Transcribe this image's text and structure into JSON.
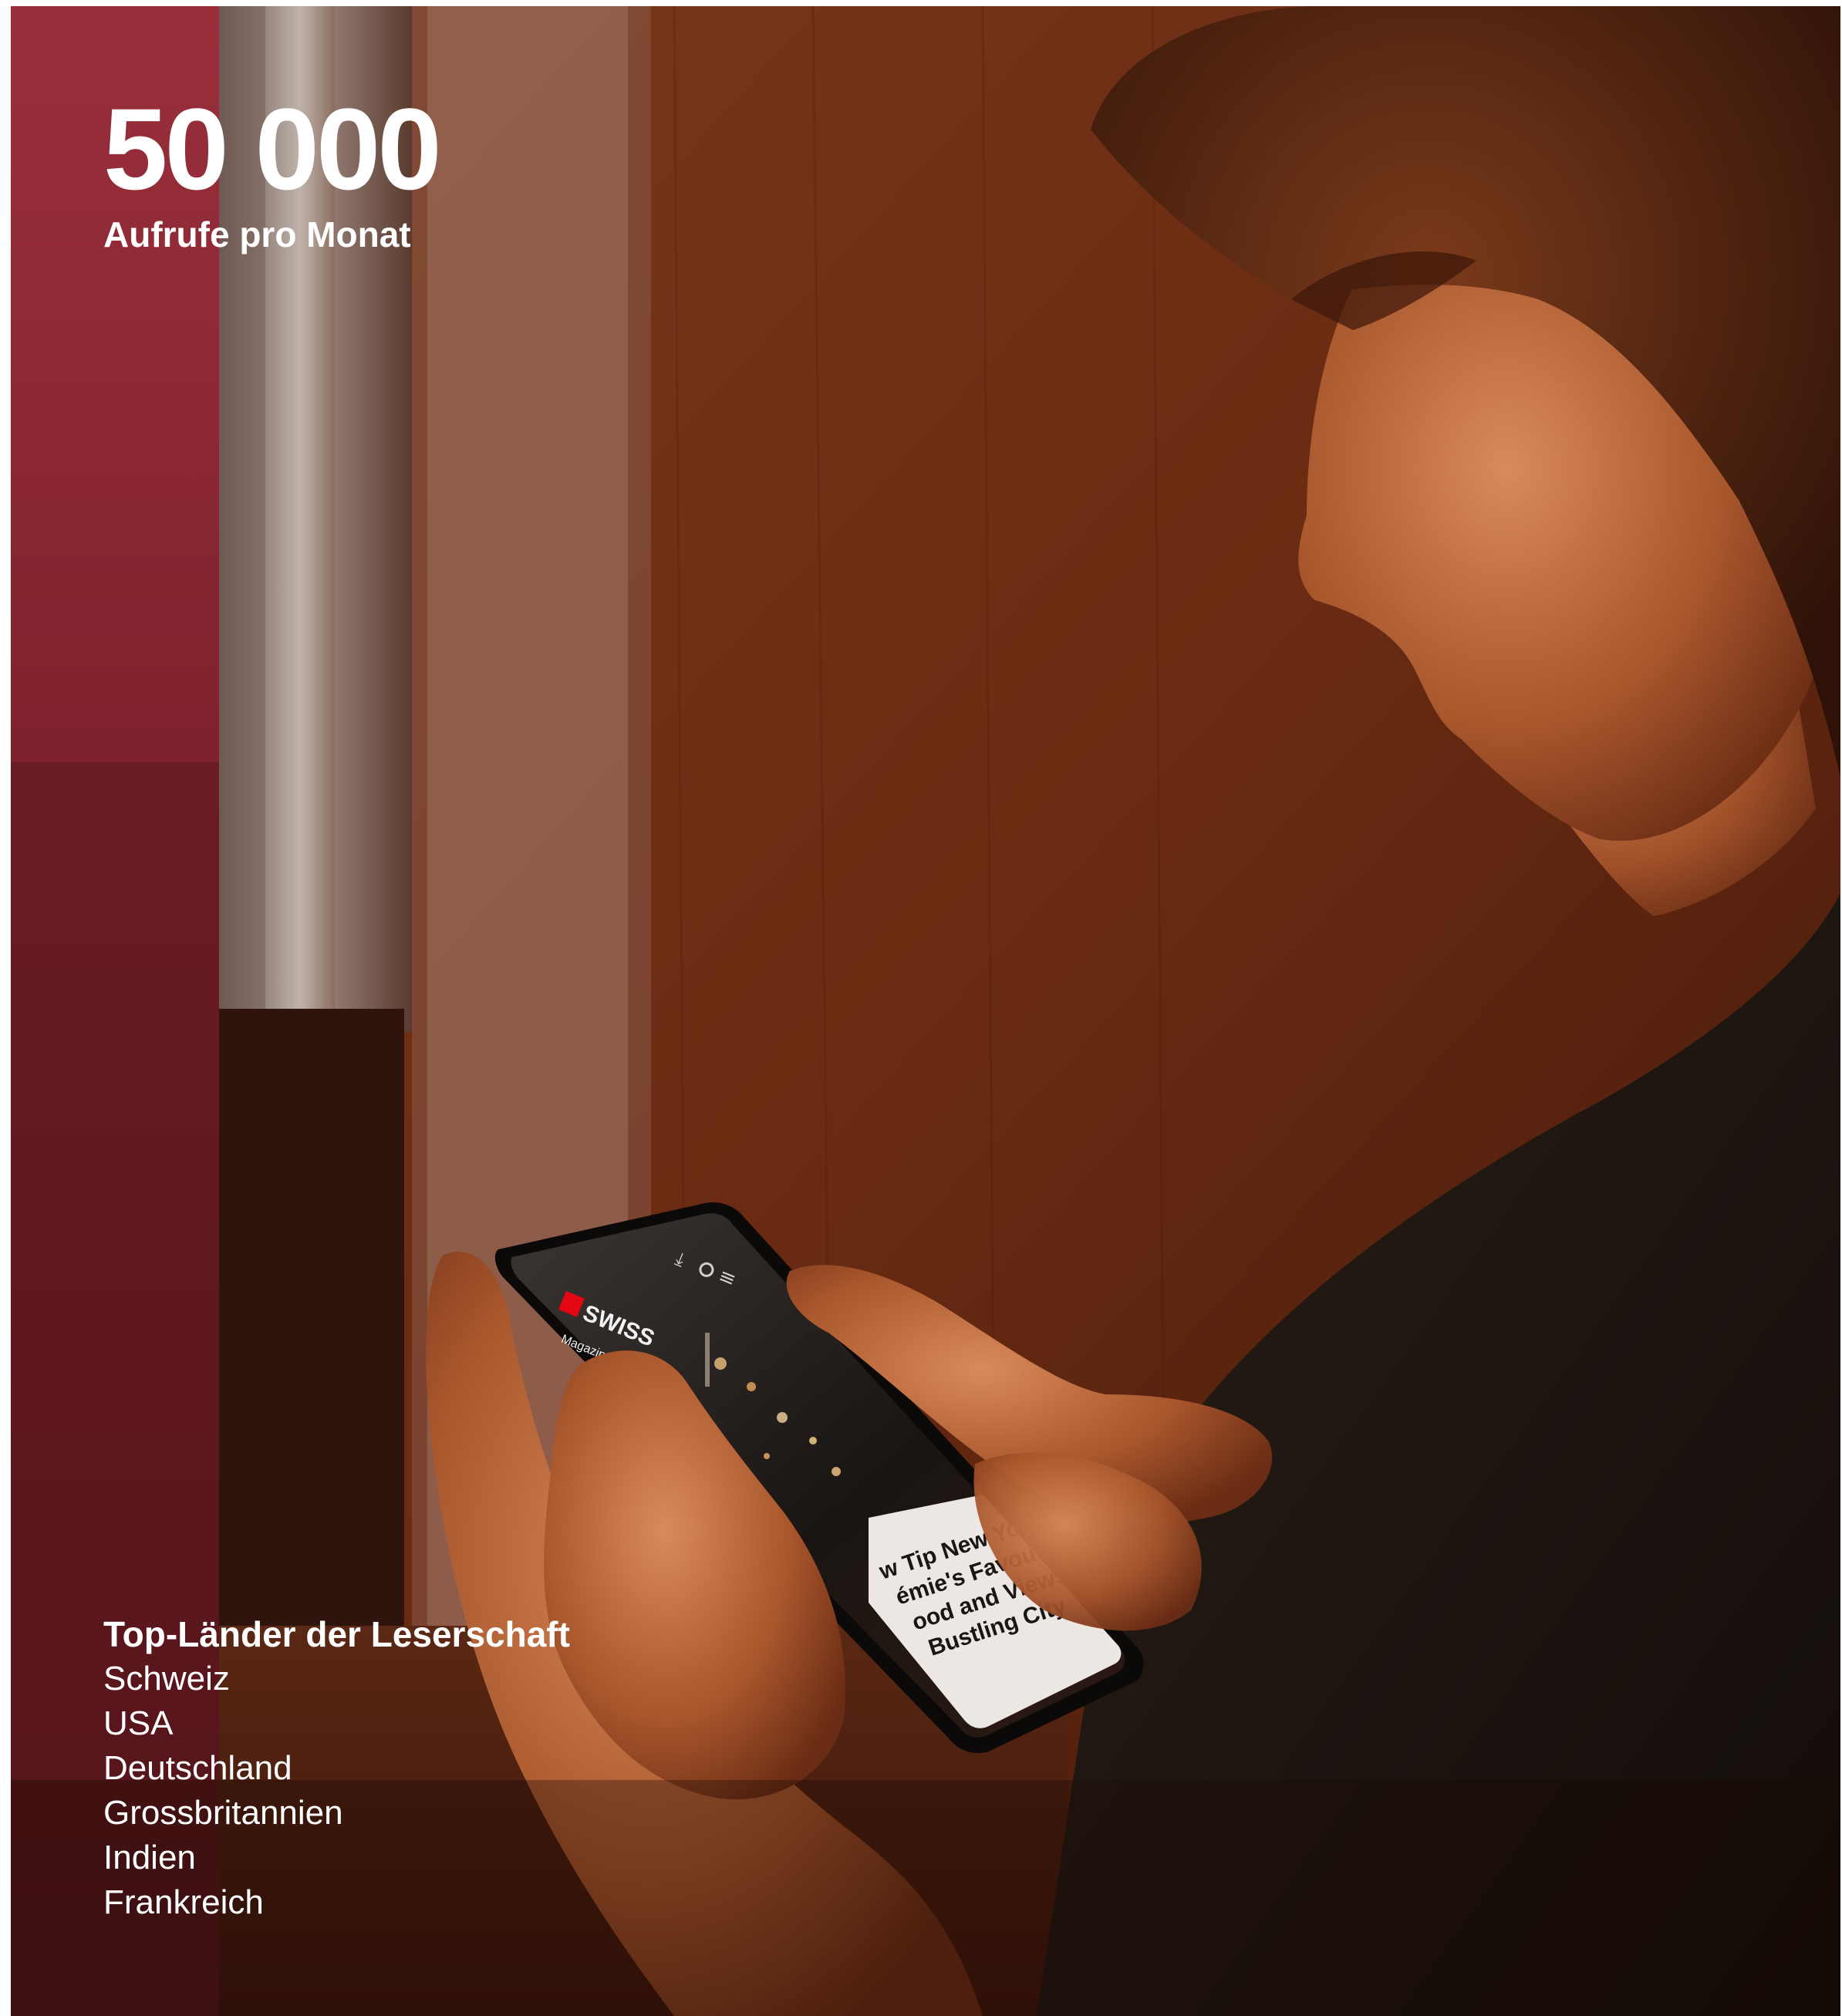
{
  "stat": {
    "number": "50 000",
    "label": "Aufrufe pro Monat"
  },
  "readership": {
    "title": "Top-Länder der Leserschaft",
    "countries": [
      "Schweiz",
      "USA",
      "Deutschland",
      "Grossbritannien",
      "Indien",
      "Frankreich"
    ]
  },
  "phone_screen": {
    "brand": "SWISS",
    "section": "Magazine",
    "headline_lines": [
      "w Tip New York:",
      "émie's Favourite",
      "ood and Views in the",
      "Bustling City"
    ]
  },
  "colors": {
    "text": "#ffffff",
    "wall_left": "#7a1f2a",
    "wall_main": "#6b2c12"
  }
}
